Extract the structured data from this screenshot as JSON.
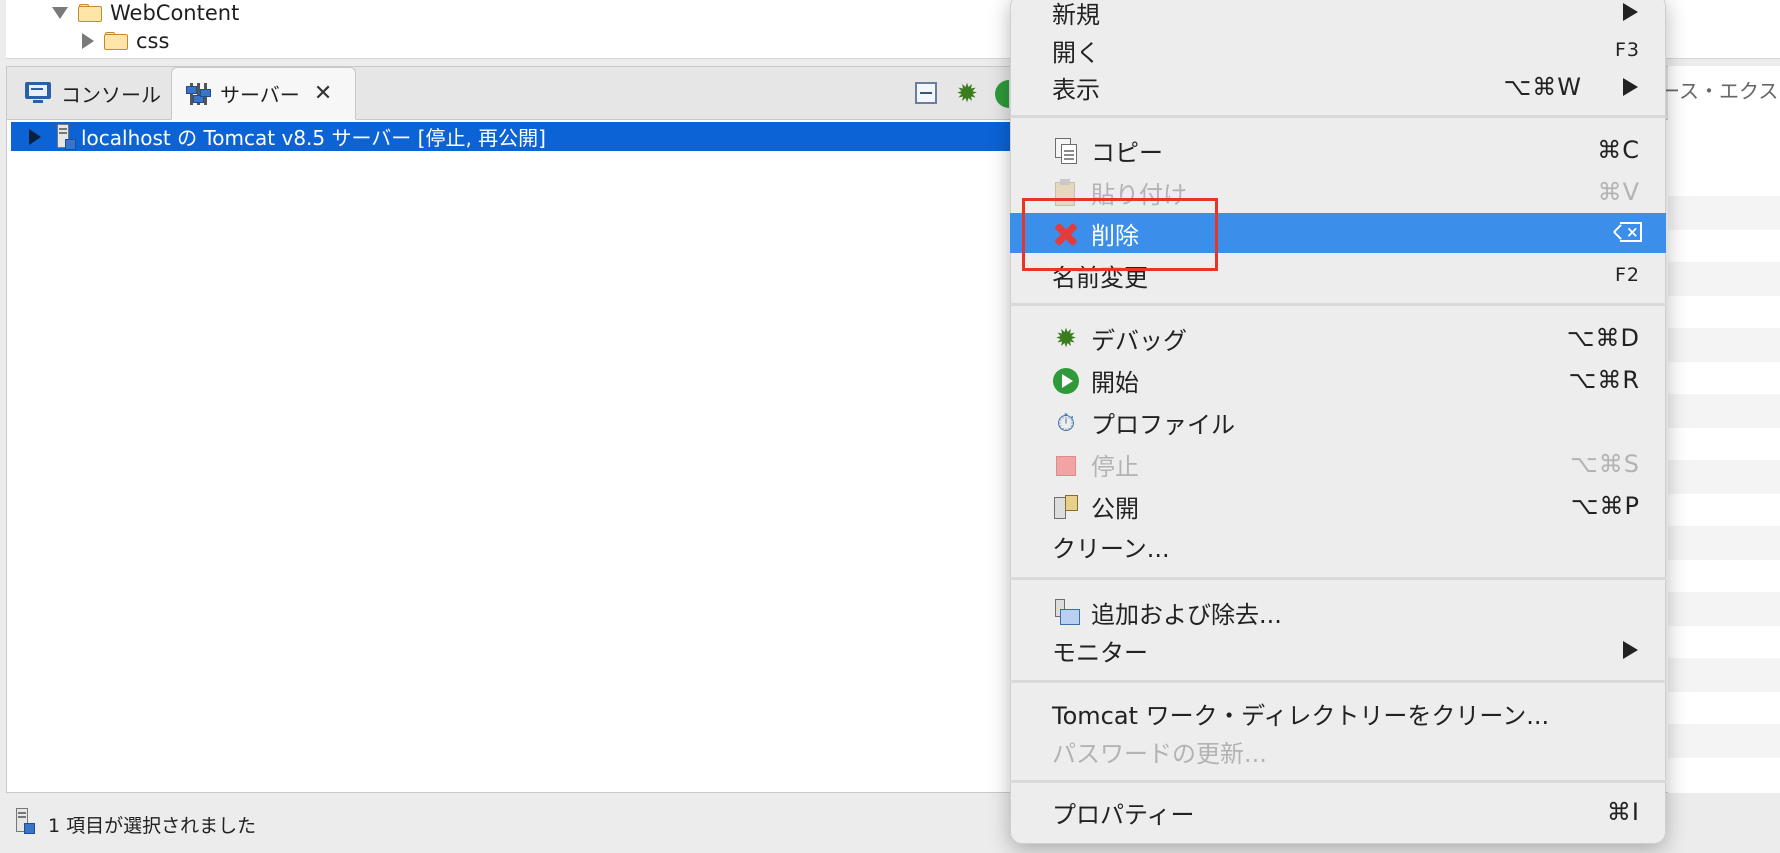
{
  "project_tree": {
    "items": [
      {
        "label": "WebContent",
        "expanded": true
      },
      {
        "label": "css",
        "expanded": false
      }
    ]
  },
  "tabs": {
    "console_label": "コンソール",
    "servers_label": "サーバー"
  },
  "toolbar": {
    "icons": [
      "collapse-all-icon",
      "debug-icon",
      "start-icon"
    ]
  },
  "server_row": {
    "label": "localhost の Tomcat v8.5 サーバー  [停止, 再公開]"
  },
  "right_panel": {
    "tab_fragment": "ース・エクス"
  },
  "context_menu": {
    "items": [
      {
        "label": "新規",
        "submenu": true
      },
      {
        "label": "開く",
        "shortcut": "F3"
      },
      {
        "label": "表示",
        "shortcut": "⌥⌘W",
        "submenu": true
      },
      {
        "label": "コピー",
        "shortcut": "⌘C",
        "icon": "copy-icon"
      },
      {
        "label": "貼り付け",
        "shortcut": "⌘V",
        "icon": "paste-icon",
        "disabled": true
      },
      {
        "label": "削除",
        "shortcut_icon": "delete-key-icon",
        "icon": "delete-icon",
        "highlighted": true
      },
      {
        "label": "名前変更",
        "shortcut": "F2"
      },
      {
        "label": "デバッグ",
        "shortcut": "⌥⌘D",
        "icon": "debug-icon"
      },
      {
        "label": "開始",
        "shortcut": "⌥⌘R",
        "icon": "start-icon"
      },
      {
        "label": "プロファイル",
        "icon": "profile-icon"
      },
      {
        "label": "停止",
        "shortcut": "⌥⌘S",
        "icon": "stop-icon",
        "disabled": true
      },
      {
        "label": "公開",
        "shortcut": "⌥⌘P",
        "icon": "publish-icon"
      },
      {
        "label": "クリーン..."
      },
      {
        "label": "追加および除去...",
        "icon": "add-remove-icon"
      },
      {
        "label": "モニター",
        "submenu": true
      },
      {
        "label": "Tomcat ワーク・ディレクトリーをクリーン..."
      },
      {
        "label": "パスワードの更新...",
        "disabled": true
      },
      {
        "label": "プロパティー",
        "shortcut": "⌘I"
      }
    ]
  },
  "status_bar": {
    "text": "1 項目が選択されました"
  },
  "colors": {
    "selection": "#0b63d6",
    "menu_highlight": "#3b8eea",
    "annotation_box": "#e8352a"
  }
}
